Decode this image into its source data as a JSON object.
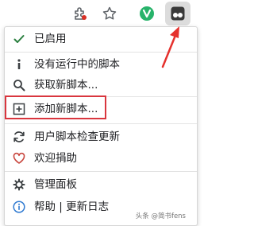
{
  "toolbar": {
    "icons": [
      "extension-puzzle-icon",
      "star-bookmark-icon",
      "vpn-extension-icon",
      "tampermonkey-icon"
    ]
  },
  "menu": {
    "items": [
      {
        "label": "已启用",
        "icon": "check-icon"
      },
      {
        "label": "没有运行中的脚本",
        "icon": "info-icon"
      },
      {
        "label": "获取新脚本...",
        "icon": "search-icon"
      },
      {
        "label": "添加新脚本...",
        "icon": "add-square-icon"
      },
      {
        "label": "用户脚本检查更新",
        "icon": "refresh-icon"
      },
      {
        "label": "欢迎捐助",
        "icon": "heart-icon"
      },
      {
        "label": "管理面板",
        "icon": "gear-icon"
      },
      {
        "label": "帮助 | 更新日志",
        "icon": "info-circle-icon"
      }
    ]
  },
  "colors": {
    "check": "#2a7f3f",
    "heart": "#c8443c",
    "help": "#2f7ad1",
    "highlight": "#d9363e",
    "arrow": "#e5312d"
  },
  "watermark": "头条 @简书fens"
}
